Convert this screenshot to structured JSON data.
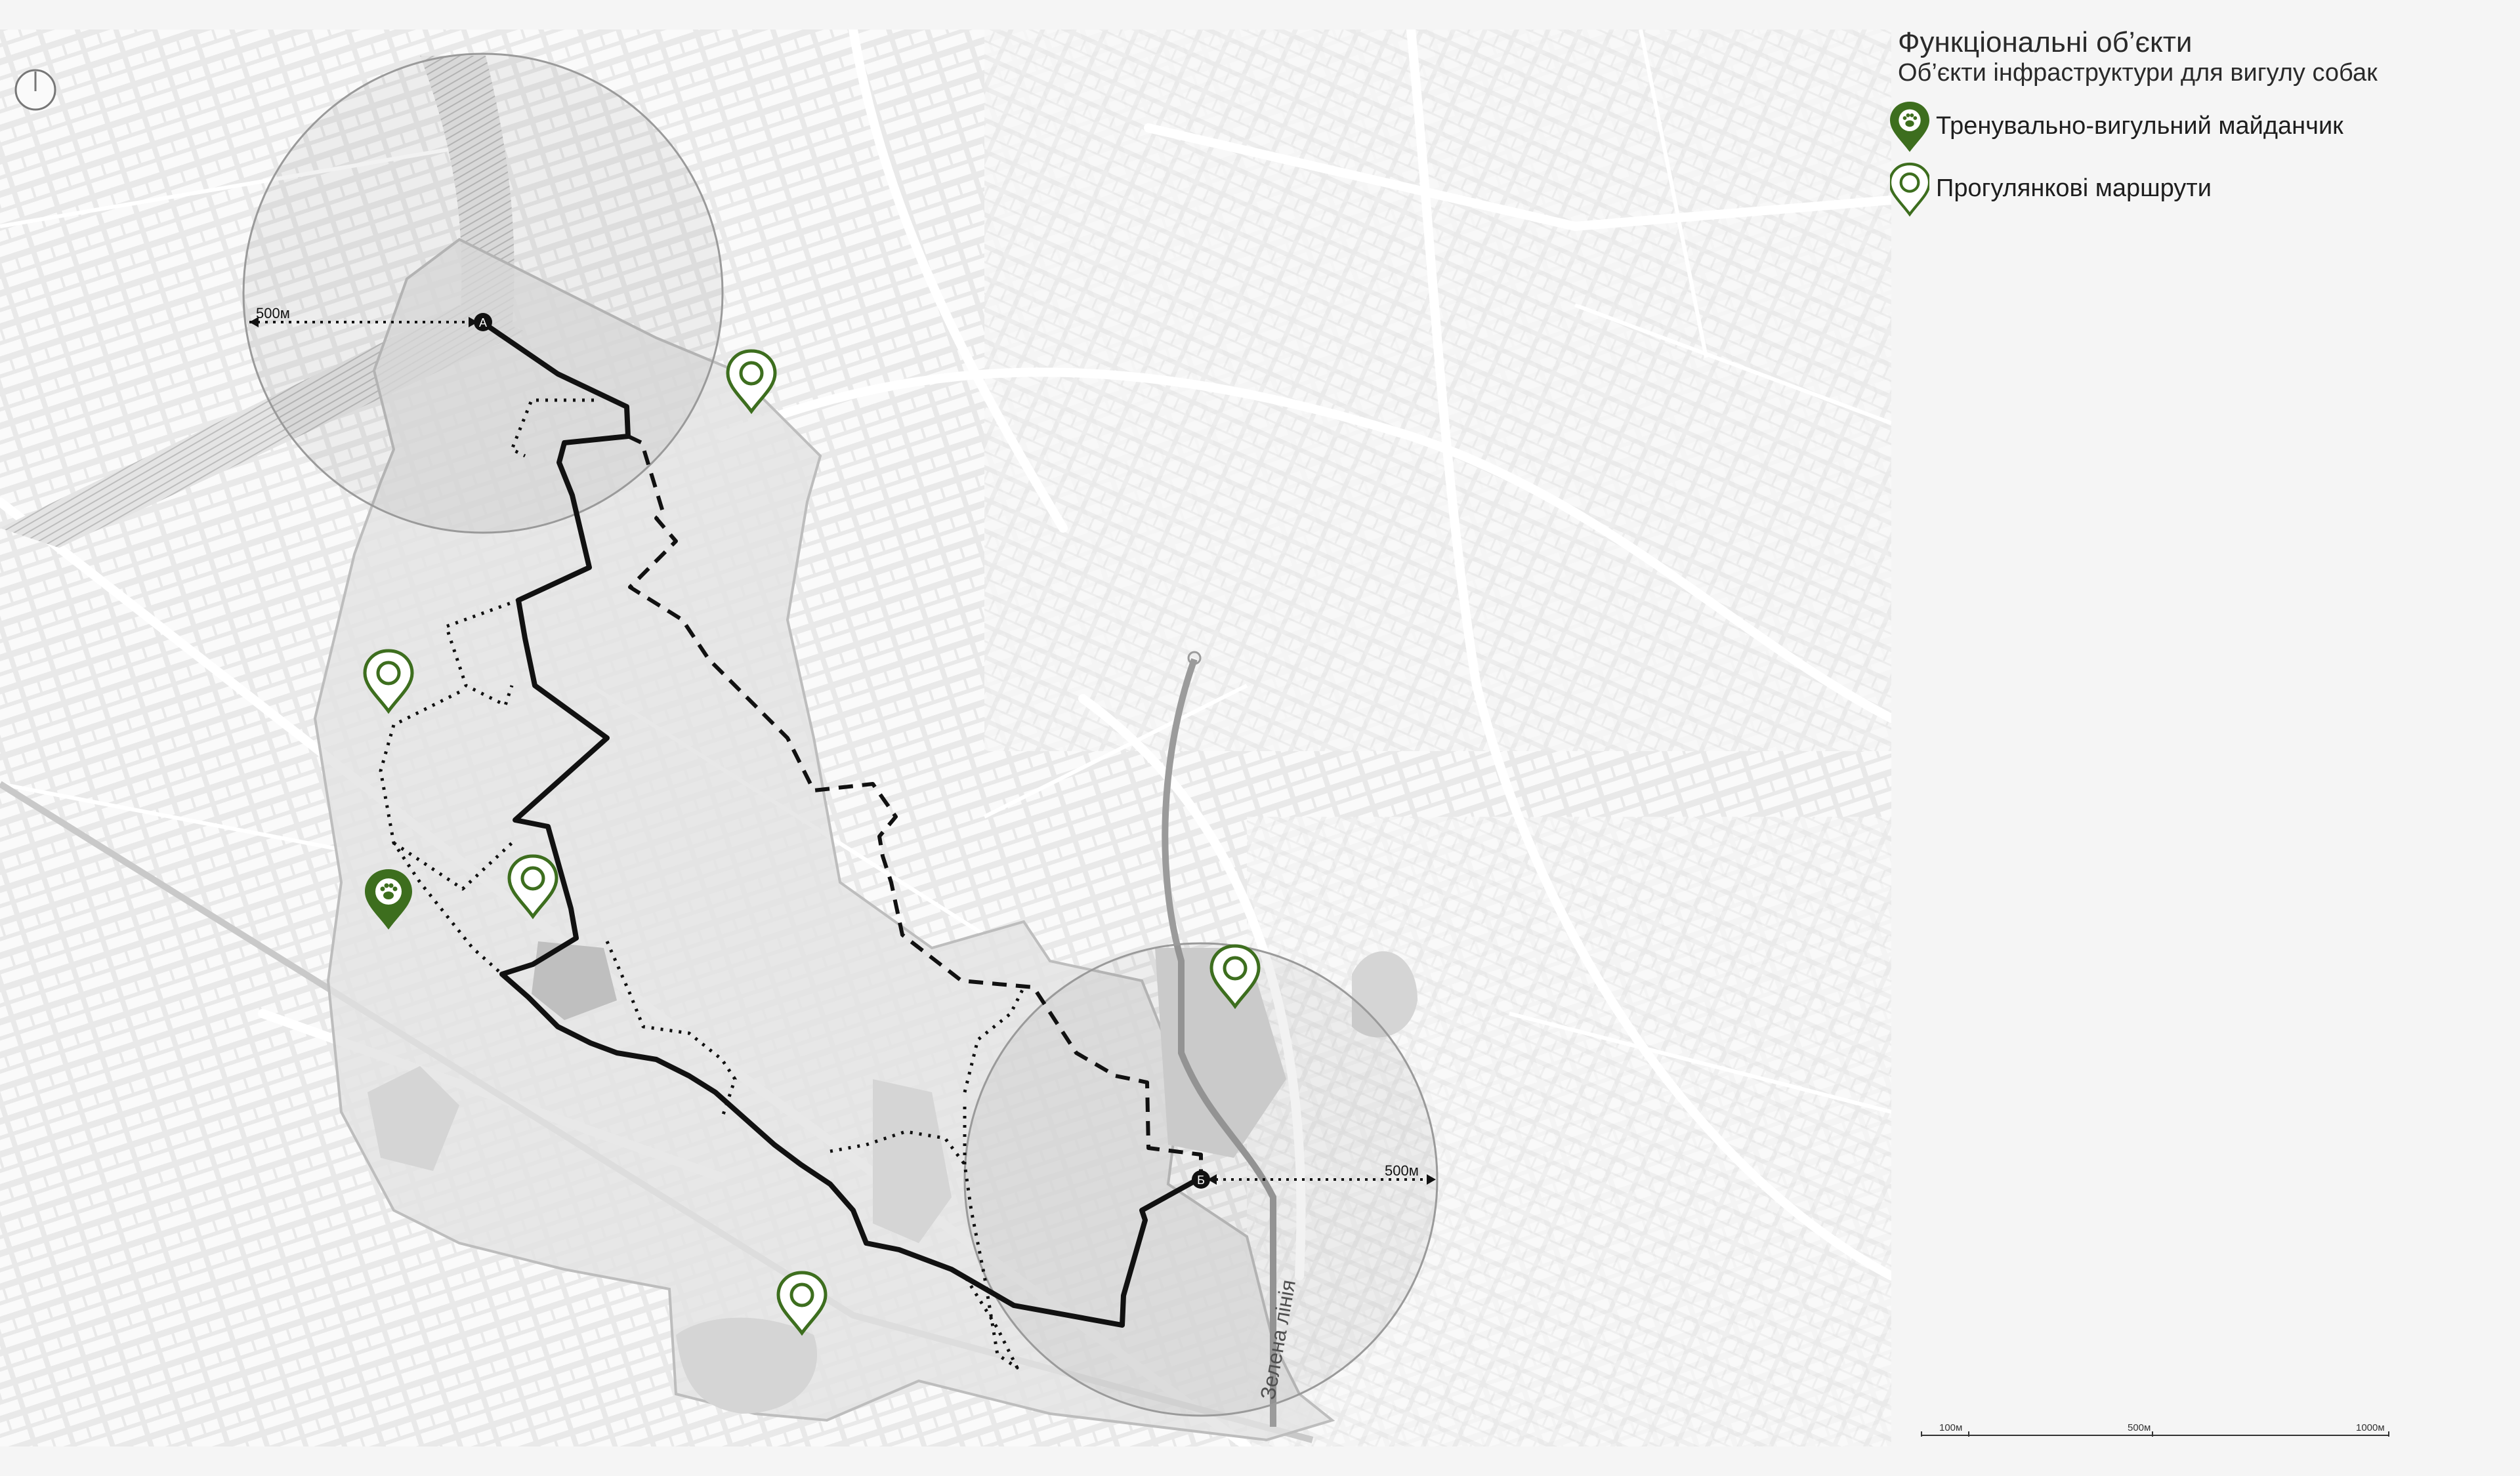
{
  "legend": {
    "title": "Функціональні об’єкти",
    "subtitle": "Об’єкти інфраструктури для вигулу собак",
    "items": [
      {
        "icon": "dog-paw-pin-icon",
        "label": "Тренувально-вигульний майданчик",
        "color": "#3d6e1e"
      },
      {
        "icon": "walk-route-pin-icon",
        "label": "Прогулянкові маршрути",
        "color": "#3d6e1e"
      }
    ]
  },
  "map": {
    "point_a": "А",
    "point_b": "Б",
    "radius_a": "500м",
    "radius_b": "500м",
    "street_label": "Зелена лінія",
    "colors": {
      "route": "#111111",
      "pin": "#3d6e1e",
      "district": "#e2e2e2",
      "streets": "#ffffff"
    }
  },
  "scalebar": {
    "labels": [
      "100м",
      "500м",
      "1000м"
    ]
  }
}
